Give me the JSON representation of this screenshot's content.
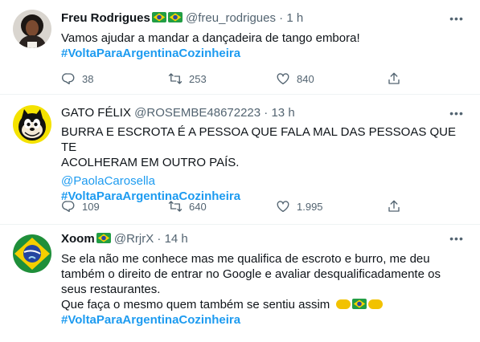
{
  "tweets": [
    {
      "name": "Freu Rodrigues",
      "handle": "@freu_rodrigues",
      "sep": "·",
      "time": "1 h",
      "lines": [
        "Vamos ajudar a mandar a dançadeira de tango embora!"
      ],
      "mention": "",
      "hashtag": "#VoltaParaArgentinaCozinheira",
      "replies": "38",
      "retweets": "253",
      "likes": "840"
    },
    {
      "name": "GATO FÉLIX",
      "handle": "@ROSEMBE48672223",
      "sep": "·",
      "time": "13 h",
      "lines": [
        "BURRA E ESCROTA É A PESSOA QUE FALA MAL DAS PESSOAS QUE TE",
        "ACOLHERAM EM OUTRO PAÍS."
      ],
      "mention": "@PaolaCarosella",
      "hashtag": "#VoltaParaArgentinaCozinheira",
      "replies": "109",
      "retweets": "640",
      "likes": "1.995"
    },
    {
      "name": "Xoom",
      "handle": "@RrjrX",
      "sep": "·",
      "time": "14 h",
      "lines": [
        "Se ela não me conhece mas me qualifica de escroto e burro, me deu",
        "também o direito de entrar no Google e avaliar desqualificadamente os",
        "seus restaurantes.",
        "Que faça o mesmo quem também se sentiu assim"
      ],
      "mention": "",
      "hashtag": "#VoltaParaArgentinaCozinheira"
    }
  ],
  "icons": {
    "more": "more-icon",
    "reply": "reply-icon",
    "retweet": "retweet-icon",
    "like": "heart-icon",
    "share": "share-icon"
  },
  "colors": {
    "link": "#1d9bf0",
    "meta": "#536471",
    "text": "#0f1419",
    "divider": "#eff3f4"
  }
}
